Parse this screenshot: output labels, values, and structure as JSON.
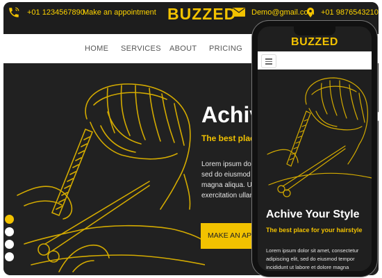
{
  "topbar": {
    "phone_left": "+01 1234567890",
    "appointment": "Make an appointment",
    "brand": "BUZZED",
    "email": "Demo@gmail.com",
    "phone_right": "+01 9876543210"
  },
  "nav": {
    "items": [
      "HOME",
      "SERVICES",
      "ABOUT",
      "PRICING"
    ]
  },
  "hero": {
    "title": "Achive Your Style",
    "subtitle": "The best place for your hairstyle",
    "body": "Lorem ipsum dolor sit amet, consectetur adipiscing elit, sed do eiusmod tempor incididunt ut labore et dolore magna aliqua. Ut enim ad minim veniam, quis nostrud exercitation ullamco laboris nisi",
    "button": "MAKE AN APPOINTMENT"
  },
  "mobile": {
    "brand": "BUZZED",
    "title": "Achive Your Style",
    "subtitle": "The best place for your hairstyle",
    "body": "Lorem ipsum dolor sit amet, consectetur adipiscing elit, sed do eiusmod tempor incididunt ut labore et dolore magna"
  },
  "slider": {
    "count": 4,
    "active": 1
  },
  "colors": {
    "accent": "#f2c200",
    "dark": "#1f1f1f",
    "nav_bg": "#ffffff"
  },
  "icons": {
    "phone": "phone-icon",
    "mail": "mail-icon",
    "location": "map-pin-icon",
    "menu": "hamburger-menu-icon"
  }
}
